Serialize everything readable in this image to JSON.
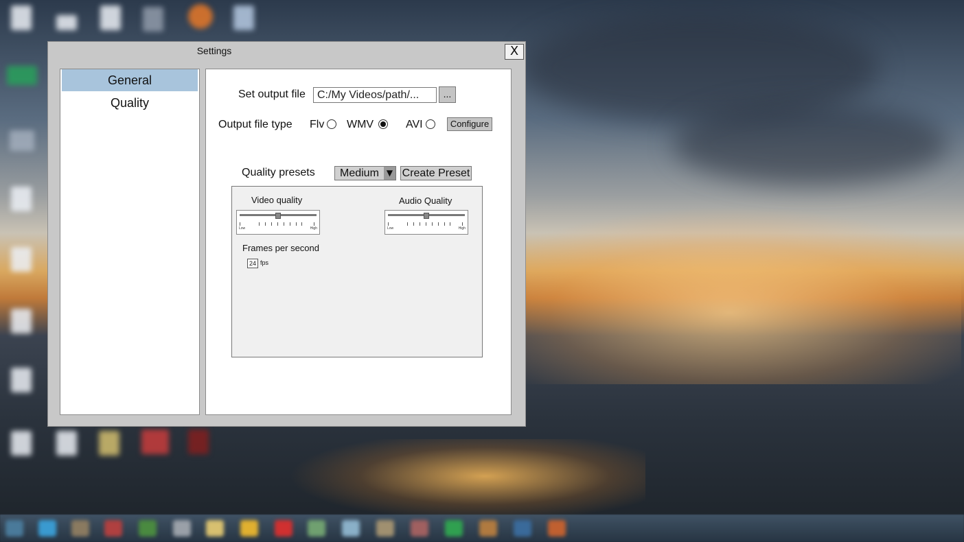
{
  "window": {
    "title": "Settings",
    "close_label": "X"
  },
  "nav": {
    "items": [
      {
        "label": "General",
        "selected": true
      },
      {
        "label": "Quality",
        "selected": false
      }
    ]
  },
  "general": {
    "output_file_label": "Set output file",
    "output_file_value": "C:/My Videos/path/...",
    "browse_label": "...",
    "file_type_label": "Output file type",
    "file_types": [
      {
        "label": "Flv",
        "selected": false
      },
      {
        "label": "WMV",
        "selected": true
      },
      {
        "label": "AVI",
        "selected": false
      }
    ],
    "configure_label": "Configure",
    "presets_label": "Quality presets",
    "preset_selected": "Medium",
    "create_preset_label": "Create Preset"
  },
  "quality": {
    "video_label": "Video quality",
    "video_level": 0.5,
    "audio_label": "Audio Quality",
    "audio_level": 0.5,
    "slider_low": "Low",
    "slider_high": "High",
    "fps_label": "Frames per second",
    "fps_value": "24",
    "fps_unit": "fps"
  },
  "colors": {
    "nav_selected": "#a8c4dc",
    "window_frame": "#c8c8c8"
  }
}
